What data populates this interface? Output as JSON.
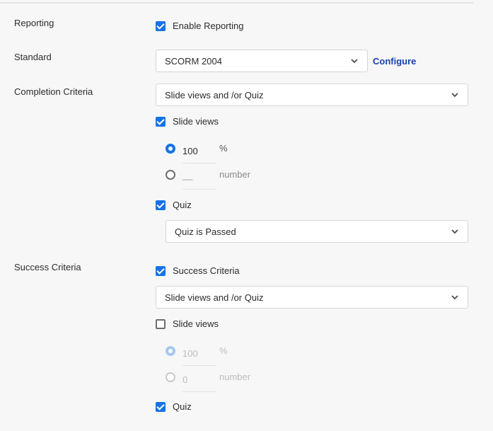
{
  "reporting": {
    "label": "Reporting",
    "enable_label": "Enable Reporting",
    "enable_checked": true
  },
  "standard": {
    "label": "Standard",
    "value": "SCORM 2004",
    "configure_label": "Configure"
  },
  "completion": {
    "label": "Completion Criteria",
    "criteria_value": "Slide views and /or Quiz",
    "slide_views": {
      "label": "Slide views",
      "checked": true,
      "percent_value": "100",
      "percent_unit": "%",
      "percent_selected": true,
      "number_value": "__",
      "number_unit": "number"
    },
    "quiz": {
      "label": "Quiz",
      "checked": true,
      "value": "Quiz is Passed"
    }
  },
  "success": {
    "label": "Success Criteria",
    "enable_label": "Success Criteria",
    "enable_checked": true,
    "criteria_value": "Slide views and /or Quiz",
    "slide_views": {
      "label": "Slide views",
      "checked": false,
      "percent_value": "100",
      "percent_unit": "%",
      "percent_selected": true,
      "number_value": "0",
      "number_unit": "number"
    },
    "quiz": {
      "label": "Quiz",
      "checked": true
    }
  },
  "colors": {
    "accent": "#1473e6",
    "link": "#1a3fae",
    "background": "#f7f7f7"
  },
  "icons": {
    "dropdown": "chevron-down-icon",
    "checkbox": "checkbox-icon",
    "radio": "radio-icon"
  }
}
